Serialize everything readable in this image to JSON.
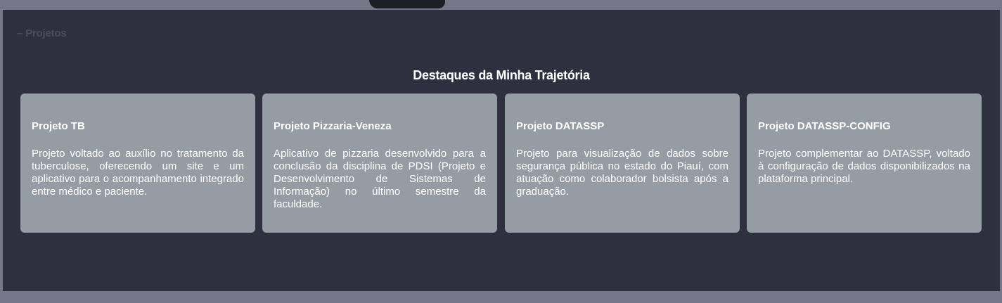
{
  "section": {
    "label": "– Projetos",
    "title": "Destaques da Minha Trajetória"
  },
  "projects": [
    {
      "title": "Projeto TB",
      "description": "Projeto voltado ao auxílio no tratamento da tuberculose, oferecendo um site e um aplicativo para o acompanhamento integrado entre médico e paciente."
    },
    {
      "title": "Projeto Pizzaria-Veneza",
      "description": "Aplicativo de pizzaria desenvolvido para a conclusão da disciplina de PDSI (Projeto e Desenvolvimento de Sistemas de Informação) no último semestre da faculdade."
    },
    {
      "title": "Projeto DATASSP",
      "description": "Projeto para visualização de dados sobre segurança pública no estado do Piauí, com atuação como colaborador bolsista após a graduação."
    },
    {
      "title": "Projeto DATASSP-CONFIG",
      "description": "Projeto complementar ao DATASSP, voltado à configuração de dados disponibilizados na plataforma principal."
    }
  ]
}
